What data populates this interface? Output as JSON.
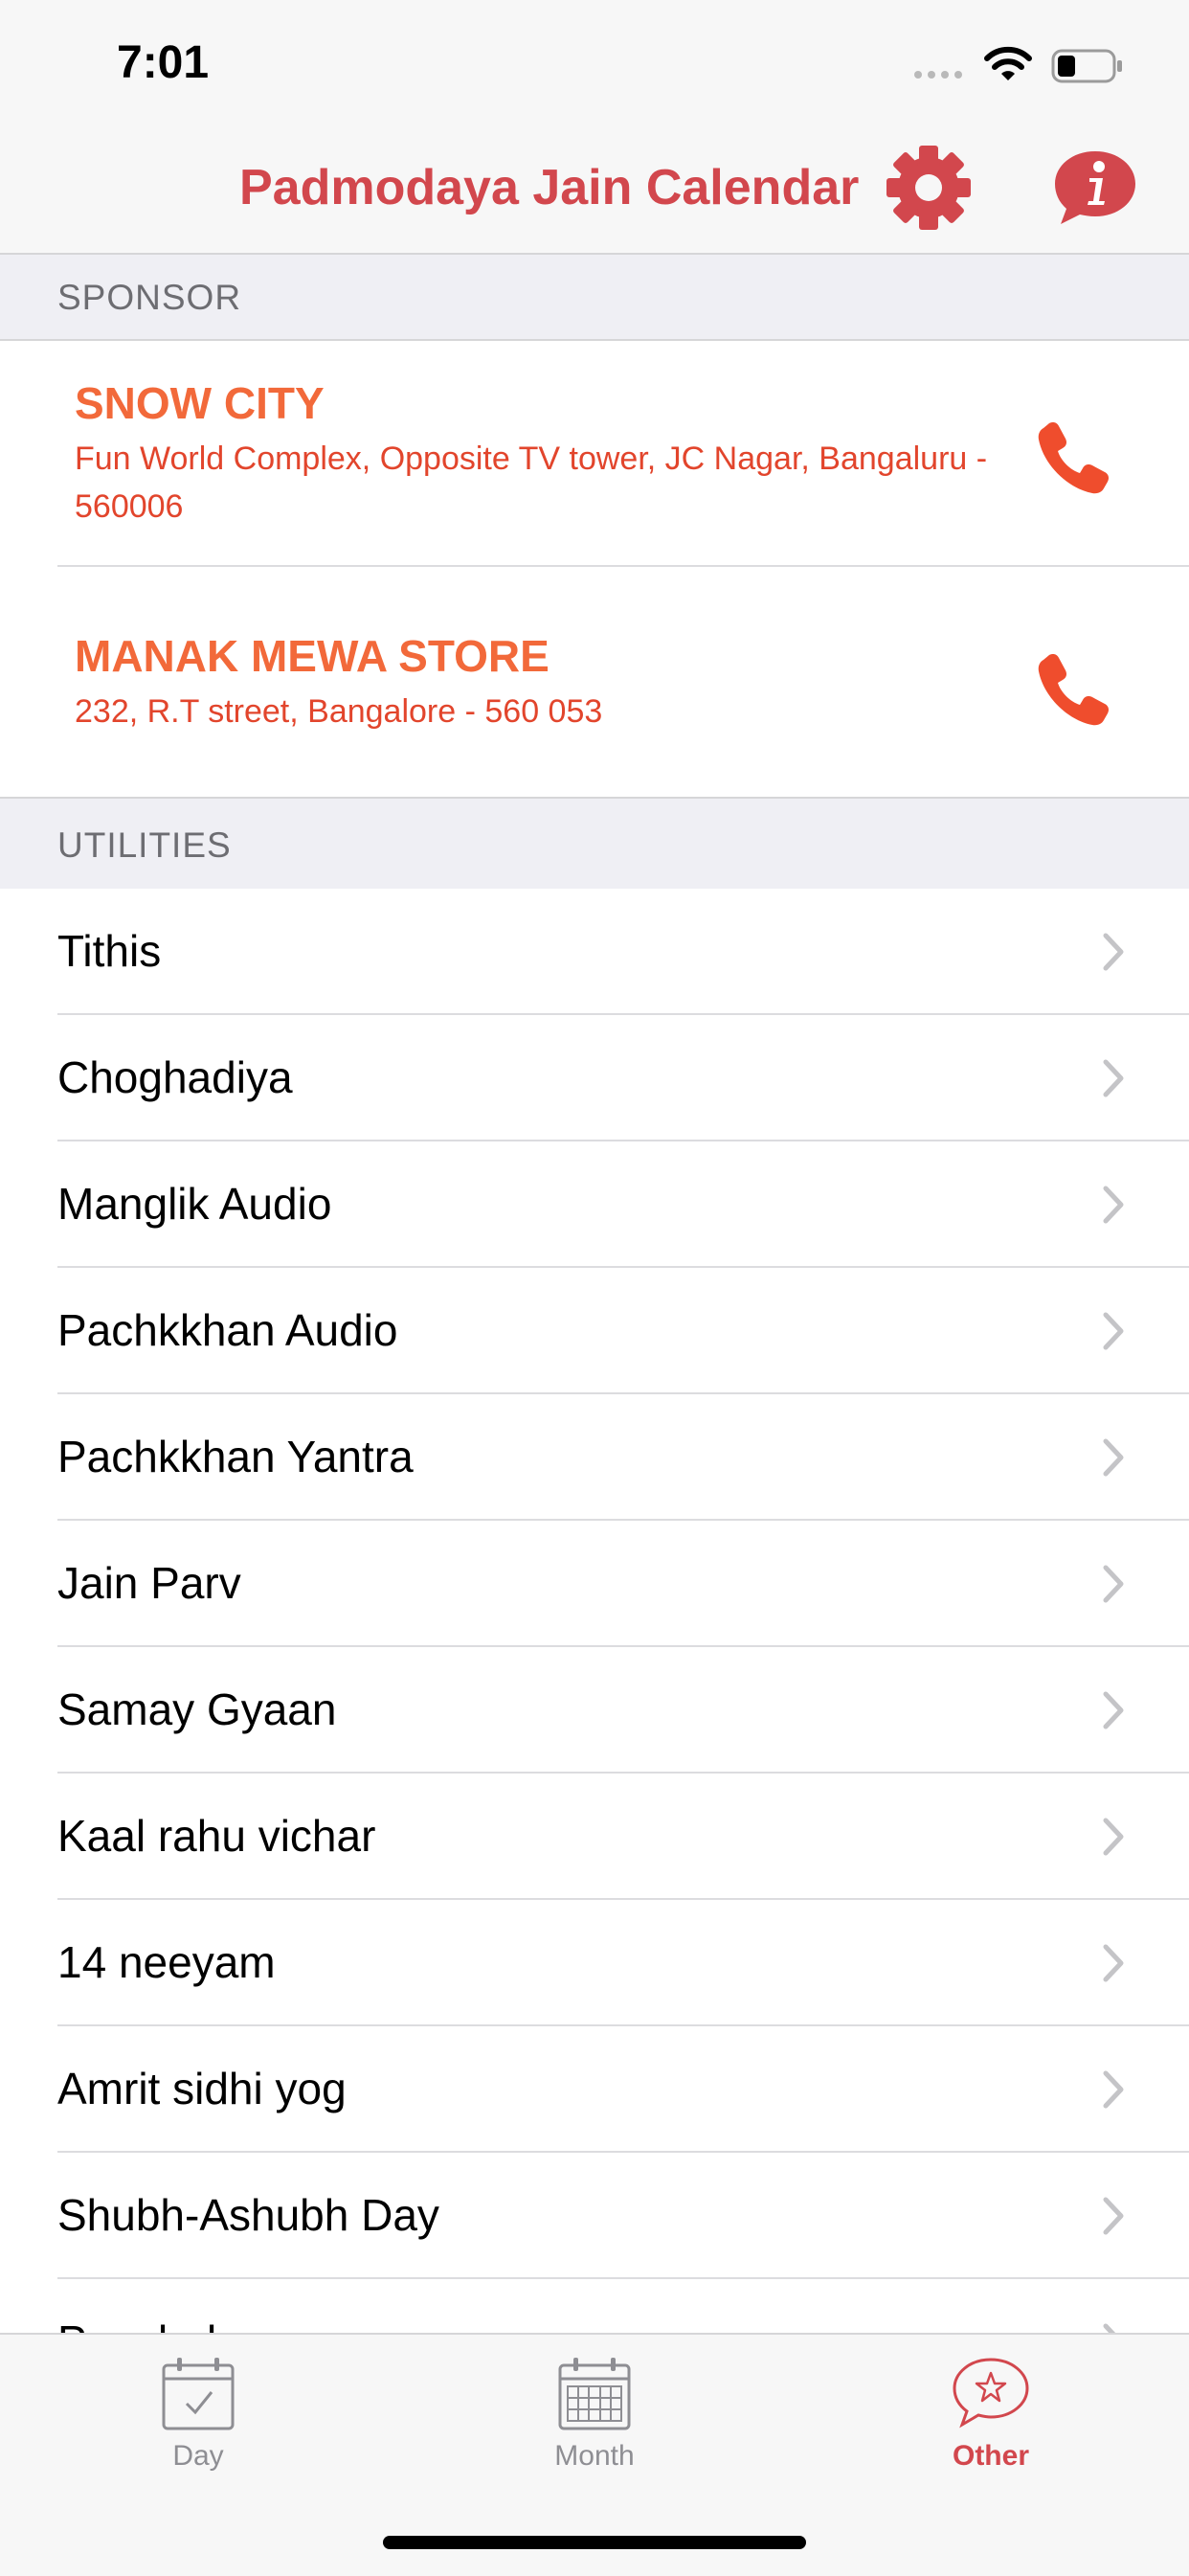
{
  "status_bar": {
    "time": "7:01"
  },
  "nav": {
    "title": "Padmodaya Jain Calendar"
  },
  "sponsor_section": {
    "header": "SPONSOR",
    "items": [
      {
        "name": "SNOW CITY",
        "address": "Fun World Complex, Opposite TV tower, JC Nagar, Bangaluru - 560006"
      },
      {
        "name": "MANAK MEWA STORE",
        "address": "232, R.T street, Bangalore - 560 053"
      }
    ]
  },
  "utilities_section": {
    "header": "UTILITIES",
    "items": [
      "Tithis",
      "Choghadiya",
      "Manglik Audio",
      "Pachkkhan Audio",
      "Pachkkhan Yantra",
      "Jain Parv",
      "Samay Gyaan",
      "Kaal rahu vichar",
      "14 neeyam",
      "Amrit sidhi yog",
      "Shubh-Ashubh Day",
      "Panchak"
    ]
  },
  "tab_bar": {
    "tabs": [
      {
        "label": "Day",
        "icon": "calendar-check-icon"
      },
      {
        "label": "Month",
        "icon": "calendar-grid-icon"
      },
      {
        "label": "Other",
        "icon": "star-bubble-icon"
      }
    ],
    "selected": "Other"
  },
  "colors": {
    "accent": "#d2474d",
    "sponsor_name": "#f2693a",
    "sponsor_address": "#e2452c",
    "tab_inactive": "#8e8e93"
  }
}
